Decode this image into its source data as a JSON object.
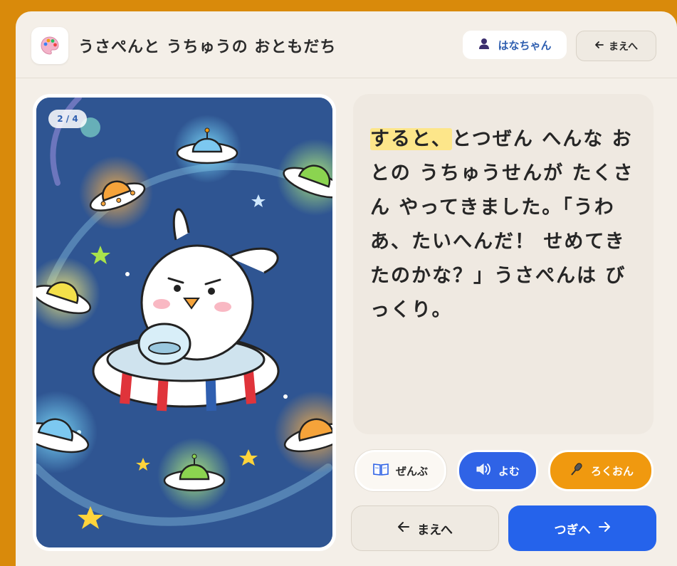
{
  "header": {
    "title": "うさぺんと うちゅうの おともだち",
    "app_icon": "palette-icon",
    "user_label": "はなちゃん",
    "user_icon": "person-icon",
    "back_label": "まえへ"
  },
  "illustration": {
    "page_indicator": "2 / 4",
    "subject": "rabbit-in-space-ring-with-ufos"
  },
  "story": {
    "highlighted": "すると、",
    "rest": "とつぜん へんな おとの うちゅうせんが たくさん やってきました。「うわあ、たいへんだ！ せめてきたのかな？」うさぺんは びっくり。"
  },
  "actions": {
    "all_label": "ぜんぶ",
    "all_icon": "book-icon",
    "read_label": "よむ",
    "read_icon": "speaker-icon",
    "record_label": "ろくおん",
    "record_icon": "microphone-icon"
  },
  "nav": {
    "prev_label": "まえへ",
    "next_label": "つぎへ"
  },
  "colors": {
    "frame": "#d98a0b",
    "card": "#f4efe8",
    "primary_blue": "#2563eb",
    "accent_orange": "#f0990f",
    "highlight": "#fde68a"
  }
}
